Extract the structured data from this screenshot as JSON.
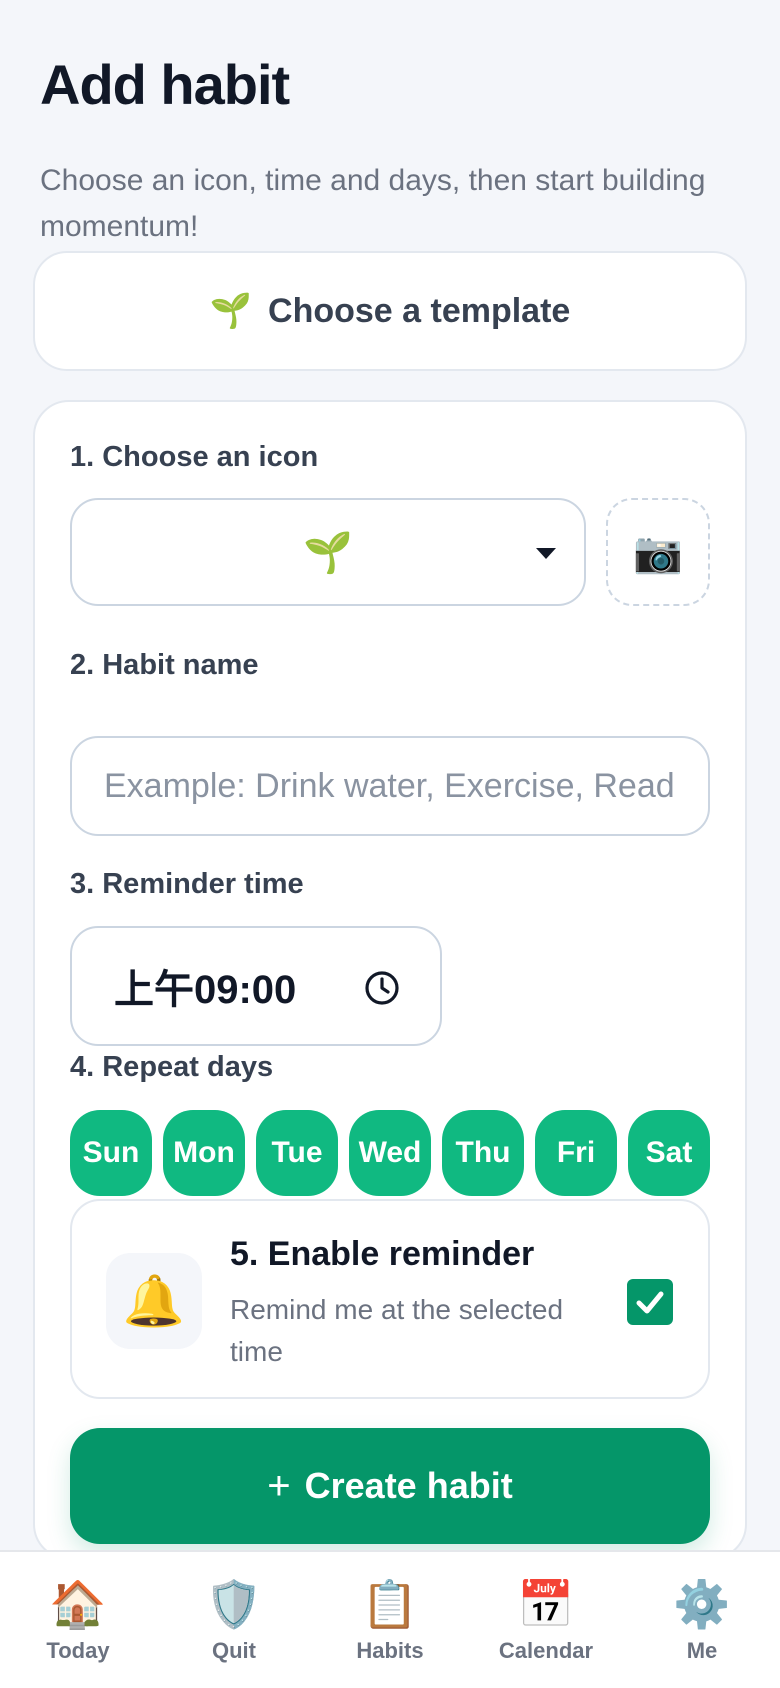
{
  "header": {
    "title": "Add habit",
    "subtitle": "Choose an icon, time and days, then start building momentum!"
  },
  "template": {
    "icon": "seedling-emoji",
    "emoji": "🌱",
    "label": "Choose a template"
  },
  "form": {
    "icon_section": {
      "label": "1. Choose an icon",
      "selected_emoji": "🌱",
      "photo_emoji": "📷"
    },
    "name_section": {
      "label": "2. Habit name",
      "value": "",
      "placeholder": "Example: Drink water, Exercise, Read"
    },
    "time_section": {
      "label": "3. Reminder time",
      "value": "上午09:00"
    },
    "days_section": {
      "label": "4. Repeat days",
      "days": [
        "Sun",
        "Mon",
        "Tue",
        "Wed",
        "Thu",
        "Fri",
        "Sat"
      ],
      "selected": [
        true,
        true,
        true,
        true,
        true,
        true,
        true
      ]
    },
    "reminder_section": {
      "bell_emoji": "🔔",
      "title": "5. Enable reminder",
      "description": "Remind me at the selected time",
      "enabled": true
    },
    "create_button": {
      "plus": "+",
      "label": "Create habit"
    }
  },
  "tabbar": [
    {
      "emoji": "🏠",
      "label": "Today",
      "icon": "house-icon"
    },
    {
      "emoji": "🛡️",
      "label": "Quit",
      "icon": "shield-icon"
    },
    {
      "emoji": "📋",
      "label": "Habits",
      "icon": "clipboard-icon"
    },
    {
      "emoji": "📅",
      "label": "Calendar",
      "icon": "calendar-icon"
    },
    {
      "emoji": "⚙️",
      "label": "Me",
      "icon": "gear-icon"
    }
  ],
  "colors": {
    "accent": "#059669",
    "day_active": "#10b981",
    "background": "#f4f6fa"
  }
}
